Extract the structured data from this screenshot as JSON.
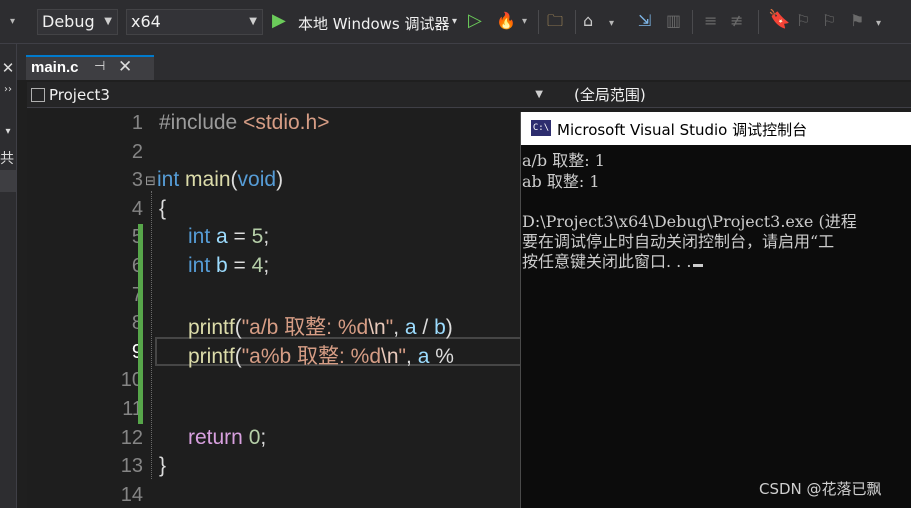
{
  "toolbar": {
    "config": "Debug",
    "platform": "x64",
    "run_label": "本地 Windows 调试器"
  },
  "left_strip": {
    "label": "共"
  },
  "tab": {
    "name": "main.c",
    "pin_icon": "pin-icon",
    "close_icon": "close-icon"
  },
  "nav": {
    "project": "Project3",
    "scope": "(全局范围)"
  },
  "editor": {
    "current_line": 9,
    "line_numbers": [
      "1",
      "2",
      "3",
      "4",
      "5",
      "6",
      "7",
      "8",
      "9",
      "10",
      "11",
      "12",
      "13",
      "14"
    ],
    "code": {
      "l1_a": "#include ",
      "l1_b": "<stdio.h>",
      "l3_int": "int",
      "l3_main": " main",
      "l3_paren_open": "(",
      "l3_void": "void",
      "l3_paren_close": ")",
      "l4": "{",
      "l5_int": "int",
      "l5_a": " a",
      "l5_eq": " = ",
      "l5_num": "5",
      "l5_semi": ";",
      "l6_int": "int",
      "l6_b": " b",
      "l6_eq": " = ",
      "l6_num": "4",
      "l6_semi": ";",
      "l8_fn": "printf",
      "l8_open": "(",
      "l8_str": "\"a/b 取整: %d",
      "l8_esc": "\\n",
      "l8_strend": "\"",
      "l8_comma": ", ",
      "l8_a": "a",
      "l8_op": " / ",
      "l8_b": "b",
      "l8_close": ")",
      "l9_fn": "printf",
      "l9_open": "(",
      "l9_str": "\"a%b 取整: %d",
      "l9_esc": "\\n",
      "l9_strend": "\"",
      "l9_comma": ", ",
      "l9_a": "a",
      "l9_op": " %",
      "l12_ret": "return",
      "l12_num": " 0",
      "l12_semi": ";",
      "l13": "}"
    }
  },
  "console": {
    "title": "Microsoft Visual Studio 调试控制台",
    "icon_label": "C:\\",
    "lines": [
      "a/b 取整: 1",
      "ab 取整: 1",
      "",
      "D:\\Project3\\x64\\Debug\\Project3.exe (进程",
      "要在调试停止时自动关闭控制台，请启用“工",
      "按任意键关闭此窗口. . ."
    ]
  },
  "watermark": "CSDN @花落已飘",
  "colors": {
    "keyword": "#569cd6",
    "function": "#dcdcaa",
    "variable": "#9cdcfe",
    "number": "#b5cea8",
    "string": "#d69d85",
    "change_bar": "#57a64a",
    "accent": "#007acc"
  }
}
